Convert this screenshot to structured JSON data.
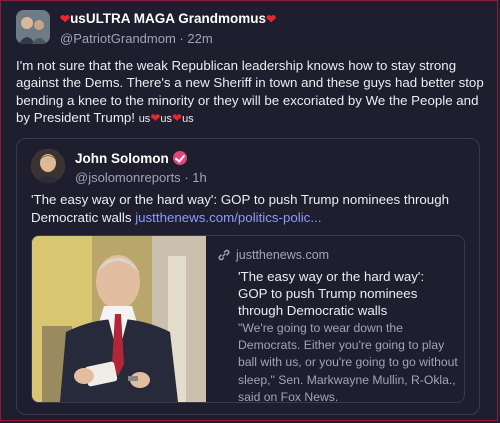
{
  "post": {
    "display_name": "usULTRA MAGA Grandmomus",
    "handle": "@PatriotGrandmom",
    "separator": "·",
    "time": "22m",
    "text": "I'm not sure that the weak Republican leadership knows how to stay strong against the Dems.  There's a new Sheriff in town and these guys had better stop bending a knee to the minority or they will be excoriated by We the People and by President Trump! ",
    "suffix_tokens": [
      "us",
      "us",
      "us"
    ]
  },
  "quote": {
    "display_name": "John Solomon",
    "handle": "@jsolomonreports",
    "separator": "·",
    "time": "1h",
    "text": "'The easy way or the hard way': GOP to push Trump nominees through Democratic walls ",
    "link_text": "justthenews.com/politics-polic..."
  },
  "link_card": {
    "domain": "justthenews.com",
    "title": "'The easy way or the hard way': GOP to push Trump nominees through Democratic walls",
    "description": "\"We're going to wear down the Democrats. Either you're going to play ball with us, or you're going to go without sleep,\" Sen. Markwayne Mullin, R-Okla., said on Fox News."
  },
  "icons": {
    "heart": "heart-icon",
    "verified": "verified-badge-icon",
    "link": "link-icon"
  },
  "colors": {
    "background": "#1e1e2e",
    "heart": "#e8262e",
    "link": "#8b9cff",
    "verified": "#e0457b"
  }
}
